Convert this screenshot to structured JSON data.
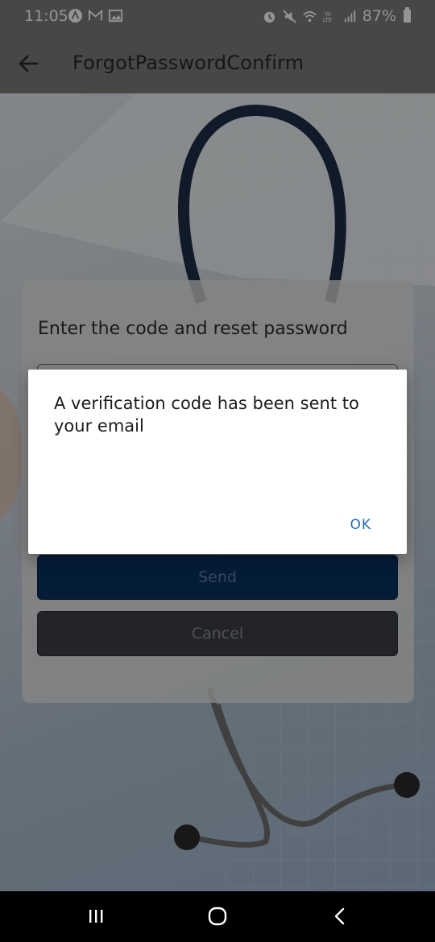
{
  "status_bar": {
    "time": "11:05",
    "battery": "87%",
    "left_icons": [
      "nav-app-icon",
      "gmail-icon",
      "gallery-icon"
    ],
    "right_icons": [
      "alarm-icon",
      "mute-icon",
      "wifi-icon",
      "volte-icon",
      "signal-icon",
      "battery-icon"
    ]
  },
  "app_bar": {
    "title": "ForgotPasswordConfirm",
    "back_icon": "arrow-left-icon"
  },
  "form": {
    "heading": "Enter the code and reset password",
    "send_label": "Send",
    "cancel_label": "Cancel"
  },
  "dialog": {
    "message": "A verification code has been sent to your email",
    "ok_label": "OK",
    "ok_color": "#1f6fb5"
  },
  "colors": {
    "send_button": "#0a3161",
    "cancel_button": "#3b3f44"
  }
}
